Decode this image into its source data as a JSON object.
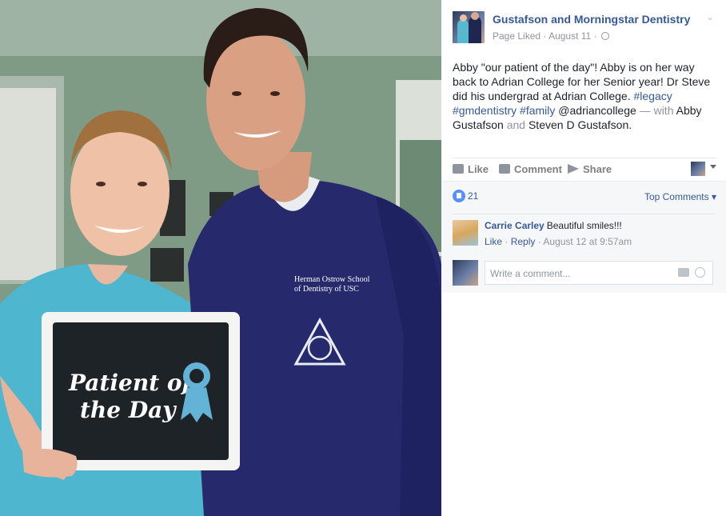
{
  "photo": {
    "sign_line1": "Patient of",
    "sign_line2": "the Day",
    "scrubs_text_line1": "Herman Ostrow School",
    "scrubs_text_line2": "of Dentistry of USC"
  },
  "post": {
    "page_name": "Gustafson and Morningstar Dentistry",
    "liked_status": "Page Liked",
    "date": "August 11",
    "body_part1": "Abby \"our patient of the day\"! Abby is on her way back to Adrian College for her Senior year! Dr Steve did his undergrad at Adrian College. ",
    "tag_legacy": "#legacy",
    "tag_gmdentistry": "#gmdentistry",
    "tag_family": "#family",
    "mention": "@adriancollege",
    "with_label": "— with",
    "tagged_person1": "Abby Gustafson",
    "and_label": "and",
    "tagged_person2": "Steven D Gustafson",
    "period": "."
  },
  "actions": {
    "like": "Like",
    "comment": "Comment",
    "share": "Share"
  },
  "summary": {
    "like_count": "21",
    "top_comments": "Top Comments"
  },
  "comment": {
    "author": "Carrie Carley",
    "text": "Beautiful smiles!!!",
    "like": "Like",
    "reply": "Reply",
    "timestamp": "August 12 at 9:57am"
  },
  "composer": {
    "placeholder": "Write a comment..."
  },
  "colors": {
    "link": "#365899",
    "meta": "#90949c",
    "like_badge": "#5890ff"
  }
}
